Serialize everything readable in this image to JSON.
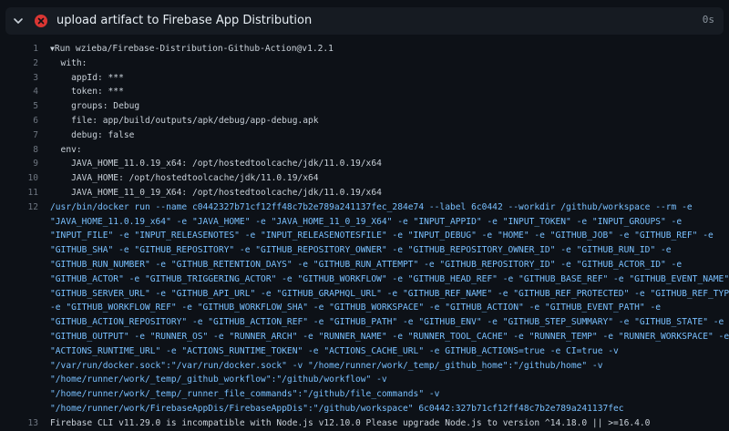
{
  "step": {
    "title": "upload artifact to Firebase App Distribution",
    "duration": "0s",
    "status": "failed"
  },
  "colors": {
    "background": "#0d1117",
    "header_bg": "#161b22",
    "error_red": "#da3633",
    "command_blue": "#79c0ff",
    "line_number": "#6e7681"
  },
  "icons": {
    "toggle": "chevron-down-icon",
    "status": "x-circle-icon",
    "group": "triangle-down-icon"
  },
  "log": {
    "lines": [
      {
        "n": "1",
        "text": "Run wzieba/Firebase-Distribution-Github-Action@v1.2.1",
        "group": true
      },
      {
        "n": "2",
        "text": "  with:"
      },
      {
        "n": "3",
        "text": "    appId: ***"
      },
      {
        "n": "4",
        "text": "    token: ***"
      },
      {
        "n": "5",
        "text": "    groups: Debug"
      },
      {
        "n": "6",
        "text": "    file: app/build/outputs/apk/debug/app-debug.apk"
      },
      {
        "n": "7",
        "text": "    debug: false"
      },
      {
        "n": "8",
        "text": "  env:"
      },
      {
        "n": "9",
        "text": "    JAVA_HOME_11.0.19_x64: /opt/hostedtoolcache/jdk/11.0.19/x64"
      },
      {
        "n": "10",
        "text": "    JAVA_HOME: /opt/hostedtoolcache/jdk/11.0.19/x64"
      },
      {
        "n": "11",
        "text": "    JAVA_HOME_11_0_19_X64: /opt/hostedtoolcache/jdk/11.0.19/x64"
      }
    ],
    "command": {
      "n": "12",
      "rows": [
        "/usr/bin/docker run --name c0442327b71cf12ff48c7b2e789a241137fec_284e74 --label 6c0442 --workdir /github/workspace --rm -e",
        "\"JAVA_HOME_11.0.19_x64\" -e \"JAVA_HOME\" -e \"JAVA_HOME_11_0_19_X64\" -e \"INPUT_APPID\" -e \"INPUT_TOKEN\" -e \"INPUT_GROUPS\" -e",
        "\"INPUT_FILE\" -e \"INPUT_RELEASENOTES\" -e \"INPUT_RELEASENOTESFILE\" -e \"INPUT_DEBUG\" -e \"HOME\" -e \"GITHUB_JOB\" -e \"GITHUB_REF\" -e",
        "\"GITHUB_SHA\" -e \"GITHUB_REPOSITORY\" -e \"GITHUB_REPOSITORY_OWNER\" -e \"GITHUB_REPOSITORY_OWNER_ID\" -e \"GITHUB_RUN_ID\" -e",
        "\"GITHUB_RUN_NUMBER\" -e \"GITHUB_RETENTION_DAYS\" -e \"GITHUB_RUN_ATTEMPT\" -e \"GITHUB_REPOSITORY_ID\" -e \"GITHUB_ACTOR_ID\" -e",
        "\"GITHUB_ACTOR\" -e \"GITHUB_TRIGGERING_ACTOR\" -e \"GITHUB_WORKFLOW\" -e \"GITHUB_HEAD_REF\" -e \"GITHUB_BASE_REF\" -e \"GITHUB_EVENT_NAME\" -e",
        "\"GITHUB_SERVER_URL\" -e \"GITHUB_API_URL\" -e \"GITHUB_GRAPHQL_URL\" -e \"GITHUB_REF_NAME\" -e \"GITHUB_REF_PROTECTED\" -e \"GITHUB_REF_TYPE\"",
        "-e \"GITHUB_WORKFLOW_REF\" -e \"GITHUB_WORKFLOW_SHA\" -e \"GITHUB_WORKSPACE\" -e \"GITHUB_ACTION\" -e \"GITHUB_EVENT_PATH\" -e",
        "\"GITHUB_ACTION_REPOSITORY\" -e \"GITHUB_ACTION_REF\" -e \"GITHUB_PATH\" -e \"GITHUB_ENV\" -e \"GITHUB_STEP_SUMMARY\" -e \"GITHUB_STATE\" -e",
        "\"GITHUB_OUTPUT\" -e \"RUNNER_OS\" -e \"RUNNER_ARCH\" -e \"RUNNER_NAME\" -e \"RUNNER_TOOL_CACHE\" -e \"RUNNER_TEMP\" -e \"RUNNER_WORKSPACE\" -e",
        "\"ACTIONS_RUNTIME_URL\" -e \"ACTIONS_RUNTIME_TOKEN\" -e \"ACTIONS_CACHE_URL\" -e GITHUB_ACTIONS=true -e CI=true -v",
        "\"/var/run/docker.sock\":\"/var/run/docker.sock\" -v \"/home/runner/work/_temp/_github_home\":\"/github/home\" -v",
        "\"/home/runner/work/_temp/_github_workflow\":\"/github/workflow\" -v",
        "\"/home/runner/work/_temp/_runner_file_commands\":\"/github/file_commands\" -v",
        "\"/home/runner/work/FirebaseAppDis/FirebaseAppDis\":\"/github/workspace\" 6c0442:327b71cf12ff48c7b2e789a241137fec"
      ]
    },
    "error": {
      "n": "13",
      "text": "Firebase CLI v11.29.0 is incompatible with Node.js v12.10.0 Please upgrade Node.js to version ^14.18.0 || >=16.4.0"
    }
  }
}
